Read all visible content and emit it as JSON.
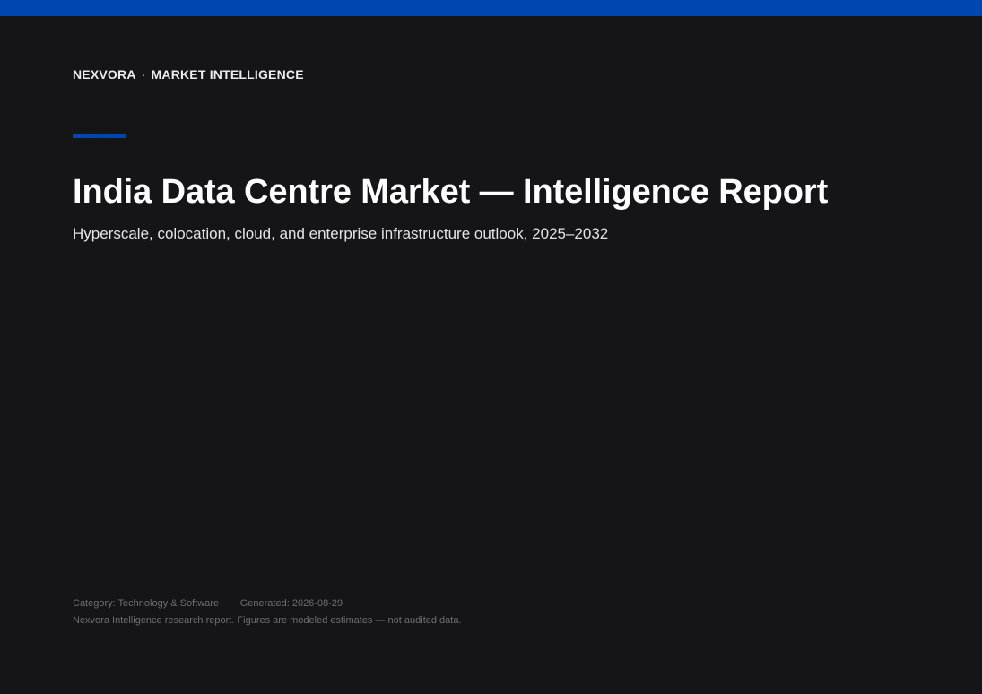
{
  "brand": {
    "name": "NEXVORA",
    "separator": "·",
    "section": "MARKET INTELLIGENCE"
  },
  "colors": {
    "accent": "#0046B0",
    "background": "#151517",
    "title_text": "#FFFFFF",
    "muted_text": "#6E6E74"
  },
  "report": {
    "title": "India Data Centre Market — Intelligence Report",
    "subtitle": "Hyperscale, colocation, cloud, and enterprise infrastructure outlook, 2025–2032"
  },
  "footer": {
    "category": "Category: Technology & Software",
    "separator": "·",
    "generated": "Generated: 2026-08-29",
    "disclaimer": "Nexvora Intelligence research report. Figures are modeled estimates — not audited data."
  }
}
